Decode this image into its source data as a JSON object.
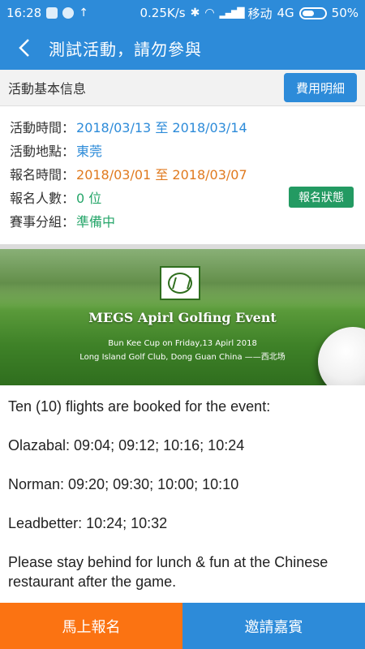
{
  "status_bar": {
    "time": "16:28",
    "network_speed": "0.25K/s",
    "carrier": "移动",
    "network_type": "4G",
    "battery": "50%"
  },
  "header": {
    "back_icon": "chevron-left-icon",
    "title": "測試活動，請勿參與"
  },
  "info_section": {
    "title": "活動基本信息",
    "fee_button": "費用明細",
    "rows": [
      {
        "label": "活動時間：",
        "value": "2018/03/13 至 2018/03/14"
      },
      {
        "label": "活動地點：",
        "value": "東莞"
      },
      {
        "label": "報名時間：",
        "value": "2018/03/01 至 2018/03/07"
      },
      {
        "label": "報名人數：",
        "value": "0 位"
      },
      {
        "label": "賽事分組：",
        "value": "準備中"
      }
    ],
    "status_button": "報名狀態"
  },
  "banner": {
    "event_title": "MEGS Apirl Golfing Event",
    "line1": "Bun Kee Cup on Friday,13 Apirl 2018",
    "line2": "Long Island Golf Club, Dong Guan China ——西北场"
  },
  "description": {
    "paragraphs": [
      "Ten (10) flights are booked for the event:",
      "Olazabal: 09:04; 09:12; 10:16; 10:24",
      "Norman: 09:20; 09:30; 10:00; 10:10",
      "Leadbetter: 10:24; 10:32",
      "Please stay behind for lunch & fun at the Chinese restaurant after the game."
    ]
  },
  "bottom": {
    "signup_button": "馬上報名",
    "invite_button": "邀請嘉賓"
  },
  "colors": {
    "primary": "#2d8bd9",
    "accent_orange": "#fb7312",
    "value_orange": "#e07a1f",
    "value_green": "#26a66a",
    "status_button": "#239a62"
  }
}
